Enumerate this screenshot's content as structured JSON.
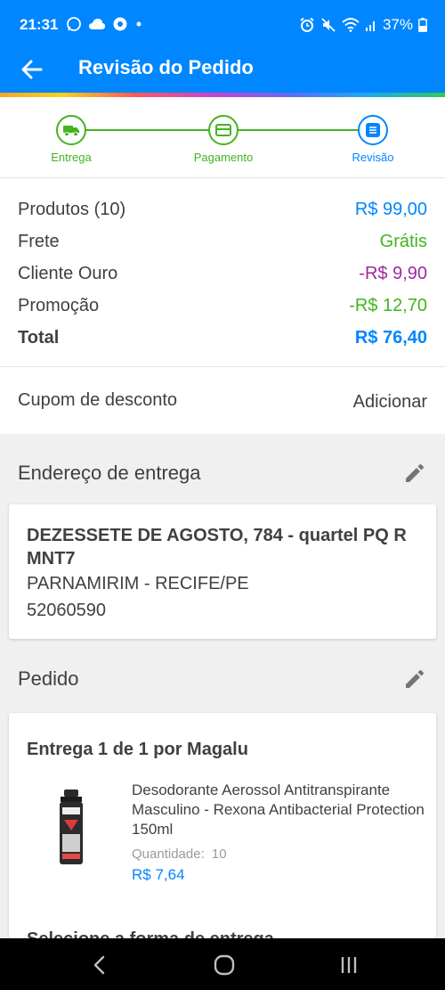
{
  "status_bar": {
    "time": "21:31",
    "battery": "37%"
  },
  "app_bar": {
    "title": "Revisão do Pedido",
    "back_icon": "arrow-left-icon"
  },
  "steps": [
    {
      "label": "Entrega",
      "icon": "truck-icon"
    },
    {
      "label": "Pagamento",
      "icon": "card-icon"
    },
    {
      "label": "Revisão",
      "icon": "list-icon"
    }
  ],
  "summary": {
    "products_label": "Produtos (10)",
    "products_value": "R$ 99,00",
    "shipping_label": "Frete",
    "shipping_value": "Grátis",
    "gold_label": "Cliente Ouro",
    "gold_value": "-R$ 9,90",
    "promo_label": "Promoção",
    "promo_value": "-R$ 12,70",
    "total_label": "Total",
    "total_value": "R$ 76,40"
  },
  "coupon": {
    "label": "Cupom de desconto",
    "action": "Adicionar"
  },
  "address": {
    "section_title": "Endereço de entrega",
    "line1": "DEZESSETE DE AGOSTO, 784 - quartel PQ R MNT7",
    "line2": "PARNAMIRIM - RECIFE/PE",
    "zip": "52060590"
  },
  "order": {
    "section_title": "Pedido",
    "delivery_title": "Entrega 1 de 1 por Magalu",
    "product_name": "Desodorante Aerossol Antitranspirante Masculino - Rexona Antibacterial Protection 150ml",
    "quantity_label": "Quantidade:",
    "quantity_value": "10",
    "price": "R$ 7,64",
    "partial_text": "Selecione a forma de entrega"
  },
  "colors": {
    "brand_blue": "#0086ff",
    "green": "#42b41f",
    "purple": "#9b2aa0"
  }
}
